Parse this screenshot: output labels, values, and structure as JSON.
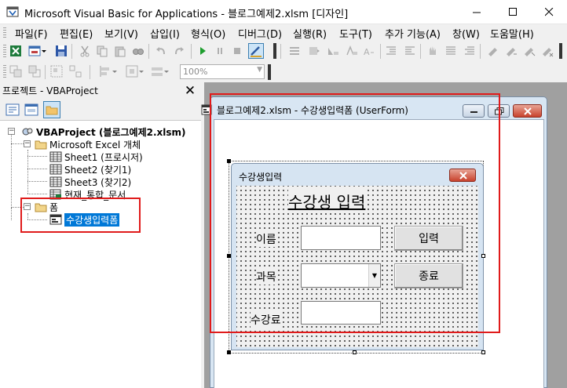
{
  "window": {
    "title": "Microsoft Visual Basic for Applications - 블로그예제2.xlsm [디자인]",
    "controls": [
      "minimize",
      "maximize",
      "close"
    ]
  },
  "menu": [
    {
      "label": "파일(F)"
    },
    {
      "label": "편집(E)"
    },
    {
      "label": "보기(V)"
    },
    {
      "label": "삽입(I)"
    },
    {
      "label": "형식(O)"
    },
    {
      "label": "디버그(D)"
    },
    {
      "label": "실행(R)"
    },
    {
      "label": "도구(T)"
    },
    {
      "label": "추가 기능(A)"
    },
    {
      "label": "창(W)"
    },
    {
      "label": "도움말(H)"
    }
  ],
  "toolbar": {
    "zoom_value": "100%"
  },
  "project_explorer": {
    "title": "프로젝트 - VBAProject",
    "close_glyph": "✕",
    "tree": {
      "root": "VBAProject (블로그예제2.xlsm)",
      "excel_folder": "Microsoft Excel 개체",
      "sheets": [
        "Sheet1 (프로시저)",
        "Sheet2 (찾기1)",
        "Sheet3 (찾기2)"
      ],
      "workbook": "현재_통합_문서",
      "forms_folder": "폼",
      "form_item": "수강생입력폼"
    }
  },
  "designer": {
    "title": "블로그예제2.xlsm - 수강생입력폼 (UserForm)",
    "userform": {
      "caption": "수강생입력",
      "heading": "수강생 입력",
      "labels": {
        "name": "이름",
        "subject": "과목",
        "fee": "수강료"
      },
      "buttons": {
        "submit": "입력",
        "exit": "종료"
      }
    }
  },
  "colors": {
    "annotation": "#e01b1b",
    "selection": "#0078d7",
    "mdi_background": "#a0a0a0"
  }
}
